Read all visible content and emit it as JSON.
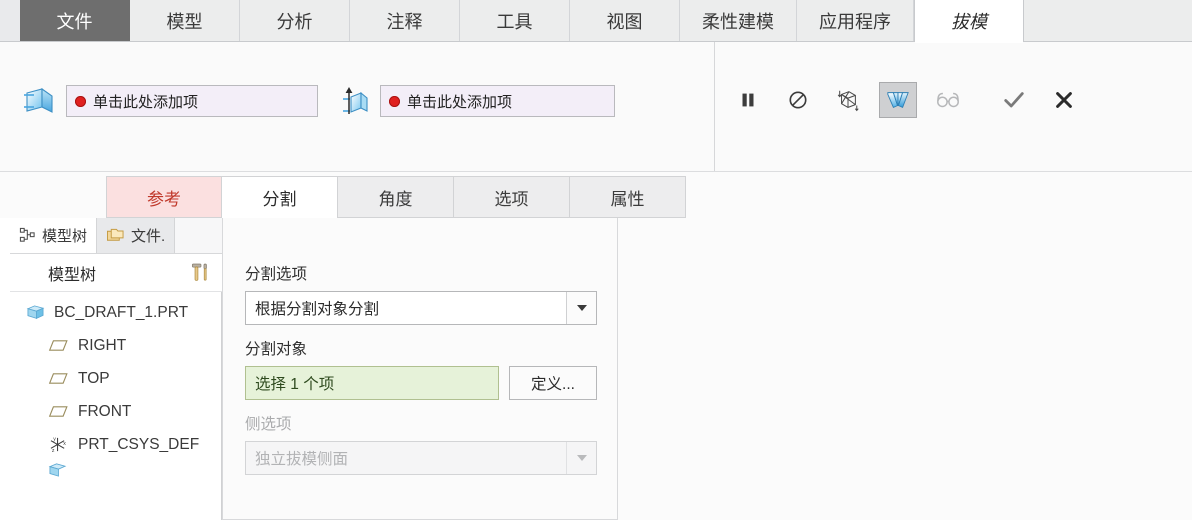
{
  "ribbon": {
    "tabs": [
      {
        "label": "文件",
        "state": "selected-dark"
      },
      {
        "label": "模型",
        "state": "normal"
      },
      {
        "label": "分析",
        "state": "normal"
      },
      {
        "label": "注释",
        "state": "normal"
      },
      {
        "label": "工具",
        "state": "normal"
      },
      {
        "label": "视图",
        "state": "normal"
      },
      {
        "label": "柔性建模",
        "state": "normal"
      },
      {
        "label": "应用程序",
        "state": "normal"
      },
      {
        "label": "拔模",
        "state": "active"
      }
    ]
  },
  "command_bar": {
    "reference_field": {
      "icon": "draft-surface-icon",
      "value": "单击此处添加项",
      "status_color": "#e02020",
      "background": "#f3eef8"
    },
    "hinge_field": {
      "icon": "draft-hinge-icon",
      "value": "单击此处添加项",
      "status_color": "#e02020",
      "background": "#f3eef8"
    },
    "tools": [
      {
        "name": "pause-icon",
        "label": "暂停",
        "state": "normal"
      },
      {
        "name": "no-entry-icon",
        "label": "取消",
        "state": "normal"
      },
      {
        "name": "wireframe-icon",
        "label": "线框",
        "state": "normal"
      },
      {
        "name": "draft-preview-icon",
        "label": "预览",
        "state": "active"
      },
      {
        "name": "glasses-icon",
        "label": "查看",
        "state": "disabled"
      },
      {
        "name": "checkmark-icon",
        "label": "确定",
        "state": "normal"
      },
      {
        "name": "close-x-icon",
        "label": "取消",
        "state": "normal"
      }
    ]
  },
  "sub_tabs": [
    {
      "label": "参考",
      "state": "error"
    },
    {
      "label": "分割",
      "state": "selected"
    },
    {
      "label": "角度",
      "state": "normal"
    },
    {
      "label": "选项",
      "state": "normal"
    },
    {
      "label": "属性",
      "state": "normal"
    }
  ],
  "navigator": {
    "tabs": [
      {
        "label": "模型树",
        "icon": "model-tree-icon",
        "state": "active"
      },
      {
        "label": "文件.",
        "icon": "folder-icon",
        "state": "inactive"
      }
    ],
    "header": {
      "title": "模型树",
      "icon": "tools-settings-icon"
    },
    "tree": [
      {
        "label": "BC_DRAFT_1.PRT",
        "icon": "part-icon",
        "level": 0
      },
      {
        "label": "RIGHT",
        "icon": "datum-plane-icon",
        "level": 1
      },
      {
        "label": "TOP",
        "icon": "datum-plane-icon",
        "level": 1
      },
      {
        "label": "FRONT",
        "icon": "datum-plane-icon",
        "level": 1
      },
      {
        "label": "PRT_CSYS_DEF",
        "icon": "csys-icon",
        "level": 1
      }
    ]
  },
  "dialog": {
    "split_option": {
      "label": "分割选项",
      "value": "根据分割对象分割",
      "enabled": true
    },
    "split_object": {
      "label": "分割对象",
      "value": "选择 1 个项",
      "button_label": "定义...",
      "enabled": true
    },
    "side_option": {
      "label": "侧选项",
      "value": "独立拔模侧面",
      "enabled": false
    }
  },
  "colors": {
    "accent_blue": "#49a6e0",
    "error_red": "#c0392b",
    "field_lavender": "#f3eef8",
    "field_green": "#e6f2d9",
    "tab_dark": "#6e6e6e"
  }
}
